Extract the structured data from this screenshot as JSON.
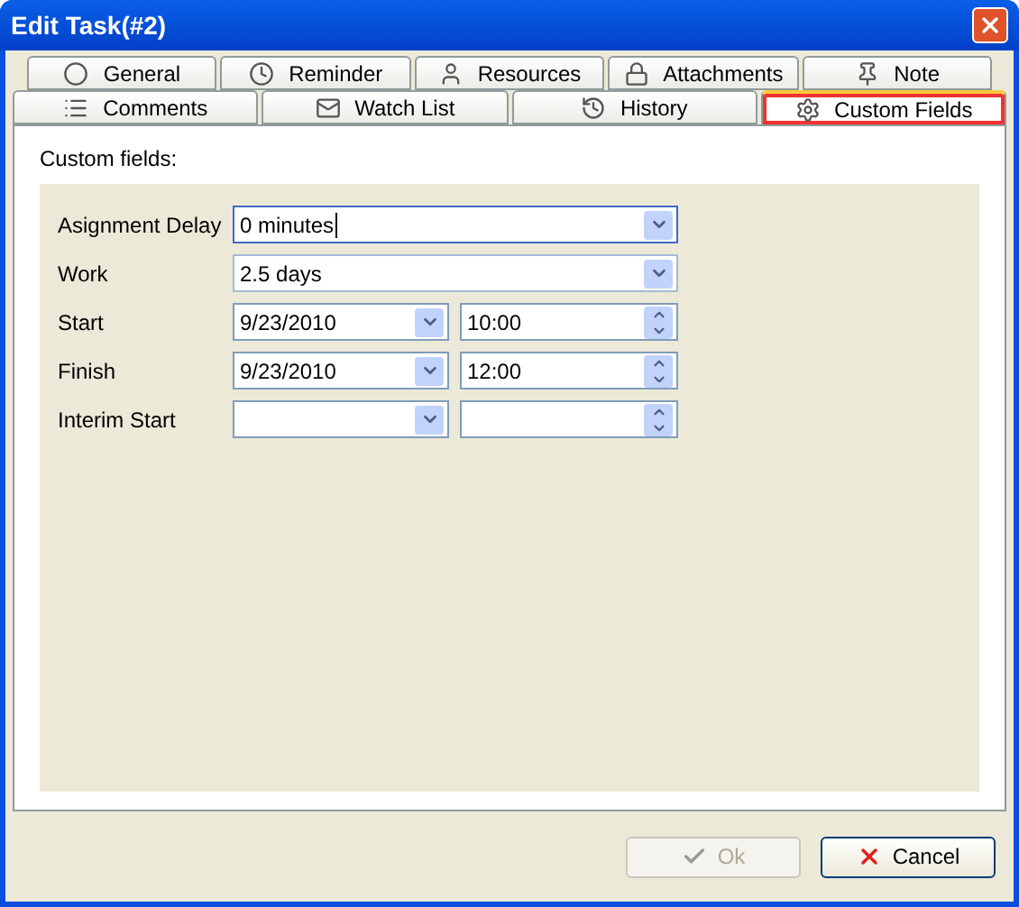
{
  "window": {
    "title": "Edit Task(#2)"
  },
  "tab_rows": [
    [
      {
        "label": "General",
        "selected": false
      },
      {
        "label": "Reminder",
        "selected": false
      },
      {
        "label": "Resources",
        "selected": false
      },
      {
        "label": "Attachments",
        "selected": false
      },
      {
        "label": "Note",
        "selected": false
      }
    ],
    [
      {
        "label": "Comments",
        "selected": false
      },
      {
        "label": "Watch List",
        "selected": false
      },
      {
        "label": "History",
        "selected": false
      },
      {
        "label": "Custom Fields",
        "selected": true
      }
    ]
  ],
  "section_label": "Custom fields:",
  "fields": [
    {
      "kind": "combo",
      "label": "Asignment Delay",
      "value": "0 minutes",
      "focused": true
    },
    {
      "kind": "combo",
      "label": "Work",
      "value": "2.5 days",
      "focused": false
    },
    {
      "kind": "datetime",
      "label": "Start",
      "date": "9/23/2010",
      "time": "10:00"
    },
    {
      "kind": "datetime",
      "label": "Finish",
      "date": "9/23/2010",
      "time": "12:00"
    },
    {
      "kind": "datetime",
      "label": "Interim Start"
    }
  ],
  "buttons": [
    {
      "label": "Ok",
      "kind": "ok",
      "disabled": true
    },
    {
      "label": "Cancel",
      "kind": "cancel",
      "disabled": false
    }
  ]
}
